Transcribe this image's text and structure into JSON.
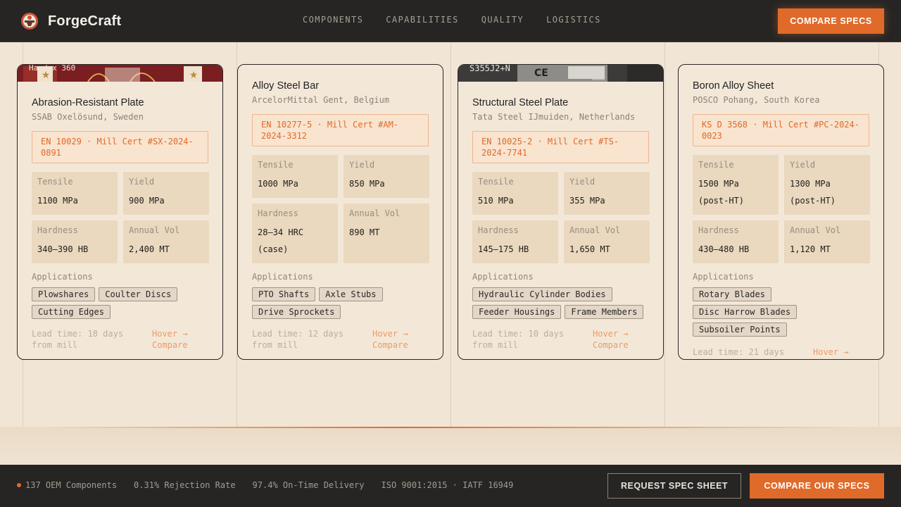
{
  "header": {
    "brand": "ForgeCraft",
    "nav": [
      "COMPONENTS",
      "CAPABILITIES",
      "QUALITY",
      "LOGISTICS"
    ],
    "cta": "COMPARE SPECS"
  },
  "cards": [
    {
      "banner_text": "Hardox 360",
      "title": "Abrasion-Resistant Plate",
      "origin": "SSAB Oxelösund, Sweden",
      "cert": "EN 10029 · Mill Cert #SX-2024-0891",
      "stats": [
        {
          "label": "Tensile",
          "value": "1100 MPa"
        },
        {
          "label": "Yield",
          "value": "900 MPa"
        },
        {
          "label": "Hardness",
          "value": "340–390 HB"
        },
        {
          "label": "Annual Vol",
          "value": "2,400 MT"
        }
      ],
      "apps_label": "Applications",
      "apps": [
        "Plowshares",
        "Coulter Discs",
        "Cutting Edges"
      ],
      "lead": "Lead time: 18 days from mill",
      "hover": "Hover → Compare"
    },
    {
      "banner_text": "",
      "title": "Alloy Steel Bar",
      "origin": "ArcelorMittal Gent, Belgium",
      "cert": "EN 10277-5 · Mill Cert #AM-2024-3312",
      "stats": [
        {
          "label": "Tensile",
          "value": "1000 MPa"
        },
        {
          "label": "Yield",
          "value": "850 MPa"
        },
        {
          "label": "Hardness",
          "value": "28–34 HRC (case)"
        },
        {
          "label": "Annual Vol",
          "value": "890 MT"
        }
      ],
      "apps_label": "Applications",
      "apps": [
        "PTO Shafts",
        "Axle Stubs",
        "Drive Sprockets"
      ],
      "lead": "Lead time: 12 days from mill",
      "hover": "Hover → Compare"
    },
    {
      "banner_text": "S355J2+N",
      "title": "Structural Steel Plate",
      "origin": "Tata Steel IJmuiden, Netherlands",
      "cert": "EN 10025-2 · Mill Cert #TS-2024-7741",
      "stats": [
        {
          "label": "Tensile",
          "value": "510 MPa"
        },
        {
          "label": "Yield",
          "value": "355 MPa"
        },
        {
          "label": "Hardness",
          "value": "145–175 HB"
        },
        {
          "label": "Annual Vol",
          "value": "1,650 MT"
        }
      ],
      "apps_label": "Applications",
      "apps": [
        "Hydraulic Cylinder Bodies",
        "Feeder Housings",
        "Frame Members"
      ],
      "lead": "Lead time: 10 days from mill",
      "hover": "Hover → Compare"
    },
    {
      "banner_text": "",
      "title": "Boron Alloy Sheet",
      "origin": "POSCO Pohang, South Korea",
      "cert": "KS D 3568 · Mill Cert #PC-2024-0023",
      "stats": [
        {
          "label": "Tensile",
          "value": "1500 MPa (post-HT)"
        },
        {
          "label": "Yield",
          "value": "1300 MPa (post-HT)"
        },
        {
          "label": "Hardness",
          "value": "430–480 HB"
        },
        {
          "label": "Annual Vol",
          "value": "1,120 MT"
        }
      ],
      "apps_label": "Applications",
      "apps": [
        "Rotary Blades",
        "Disc Harrow Blades",
        "Subsoiler Points"
      ],
      "lead": "Lead time: 21 days",
      "hover": "Hover →"
    }
  ],
  "footer": {
    "stats": [
      "137 OEM Components",
      "0.31% Rejection Rate",
      "97.4% On-Time Delivery",
      "ISO 9001:2015 · IATF 16949"
    ],
    "secondary_cta": "REQUEST SPEC SHEET",
    "primary_cta": "COMPARE OUR SPECS"
  },
  "colors": {
    "accent": "#e06a2a",
    "bar": "#262524",
    "background": "#f1e6d6"
  }
}
